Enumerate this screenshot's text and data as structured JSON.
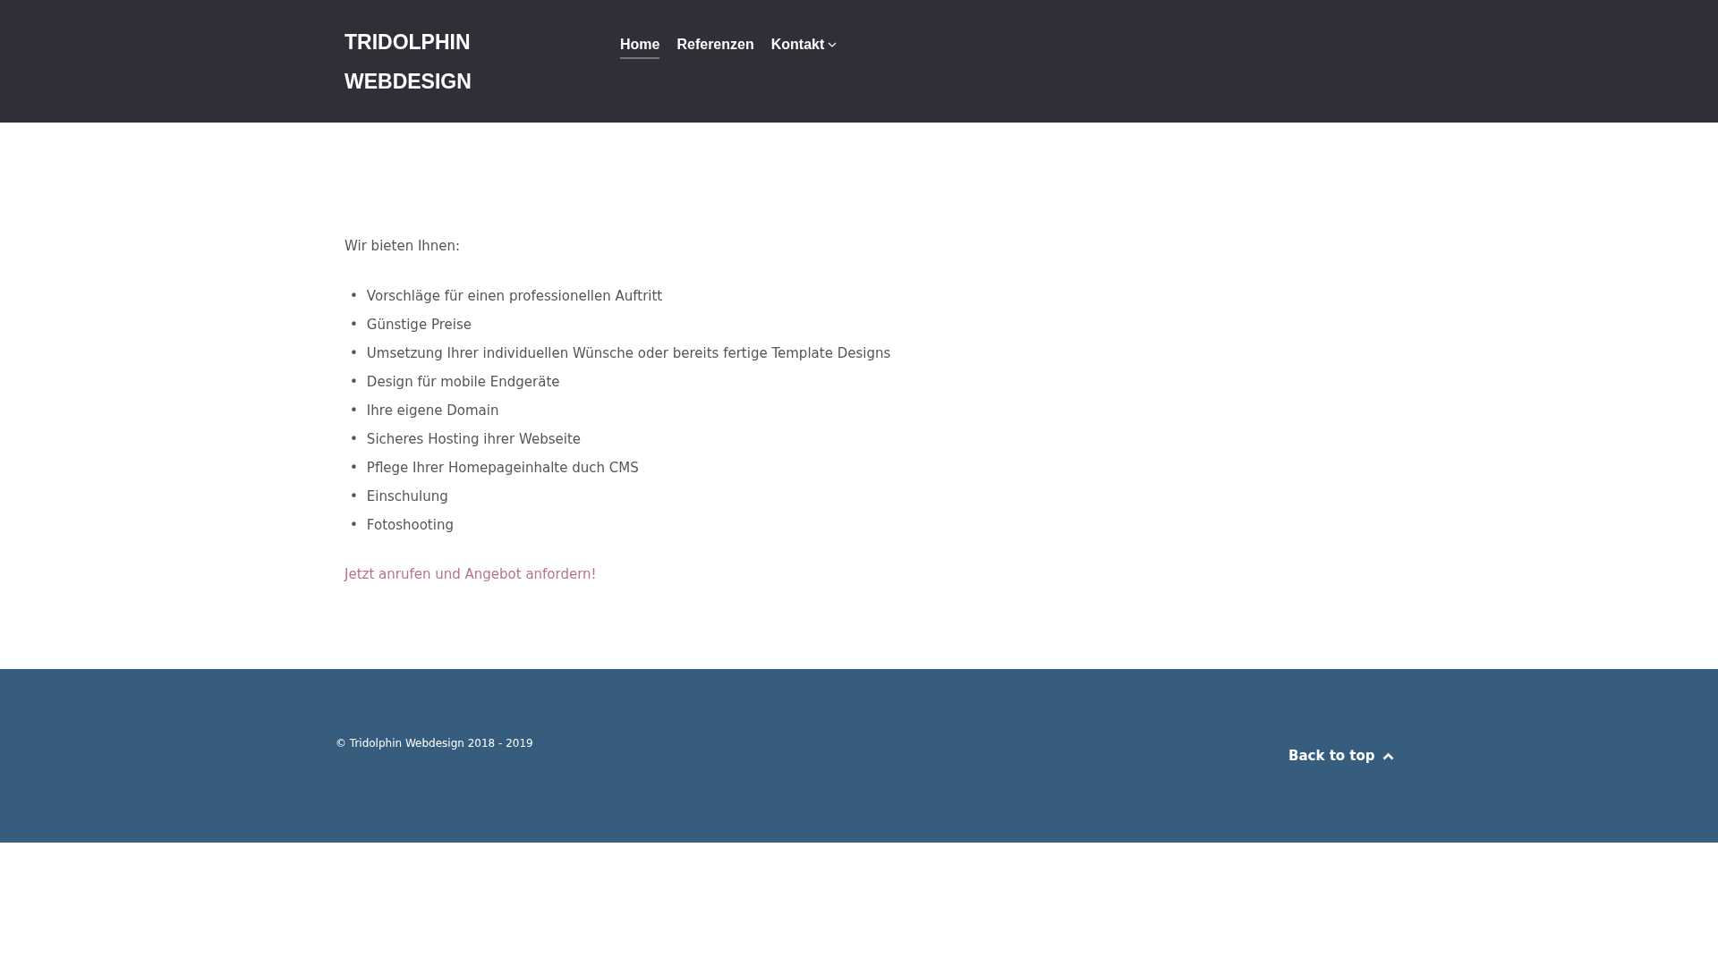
{
  "header": {
    "logo_lines": [
      "TRIDOLPHIN",
      "WEBDESIGN"
    ],
    "nav": [
      {
        "label": "Home",
        "selected": true,
        "dropdown": false
      },
      {
        "label": "Referenzen",
        "selected": false,
        "dropdown": false
      },
      {
        "label": "Kontakt",
        "selected": false,
        "dropdown": true
      }
    ]
  },
  "content": {
    "intro": "Wir bieten Ihnen:",
    "services": [
      {
        "marker": "•",
        "text": "Vorschläge für einen professionellen Auftritt"
      },
      {
        "marker": "•",
        "text": "Günstige Preise"
      },
      {
        "marker": "•",
        "text": "Umsetzung Ihrer individuellen Wünsche oder bereits fertige Template Designs"
      },
      {
        "marker": "•",
        "text": "Design für mobile Endgeräte"
      },
      {
        "marker": "•",
        "text": "Ihre eigene Domain"
      },
      {
        "marker": "•",
        "text": "Sicheres Hosting ihrer Webseite"
      },
      {
        "marker": "•",
        "text": "Pflege Ihrer Homepageinhalte duch CMS"
      },
      {
        "marker": "•",
        "text": "Einschulung"
      },
      {
        "marker": "•",
        "text": "Fotoshooting"
      }
    ],
    "call_to_action": "Jetzt anrufen und Angebot anfordern!"
  },
  "footer": {
    "copyright": "© Tridolphin Webdesign 2018 - 2019",
    "back_to_top": "Back to top"
  }
}
